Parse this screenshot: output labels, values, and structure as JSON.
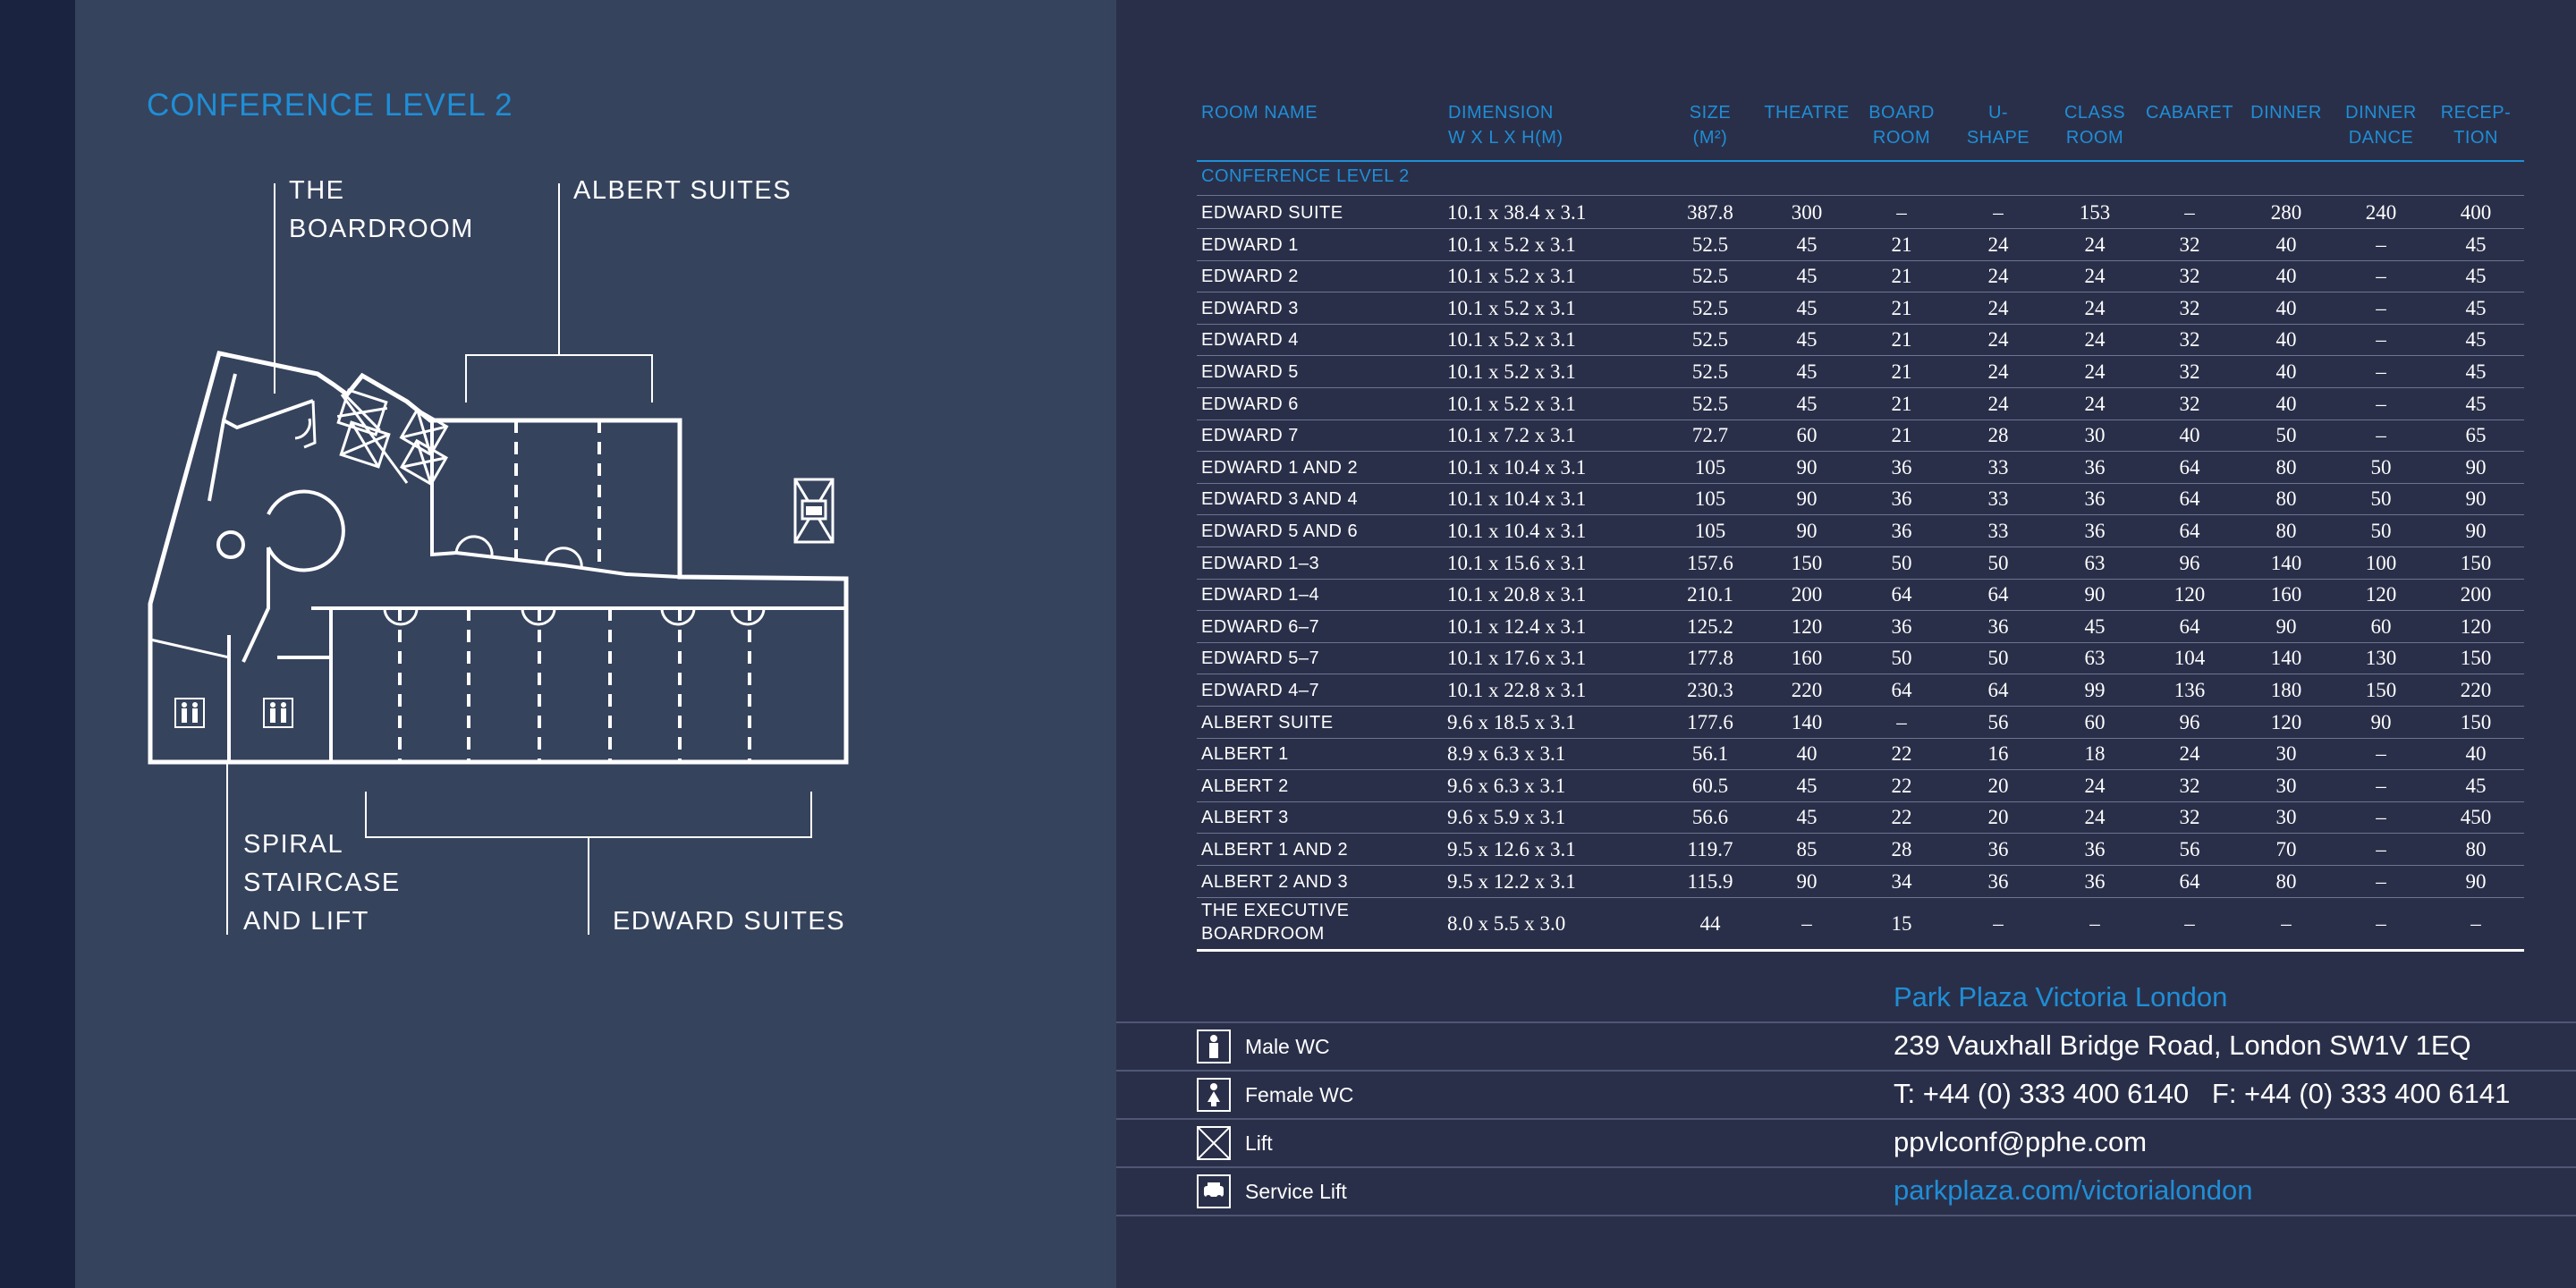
{
  "left": {
    "title": "CONFERENCE LEVEL 2",
    "labels": {
      "boardroom": "THE\nBOARDROOM",
      "albert": "ALBERT SUITES",
      "spiral": "SPIRAL\nSTAIRCASE\nAND LIFT",
      "edward": "EDWARD SUITES"
    }
  },
  "table": {
    "headers": {
      "room": "ROOM NAME",
      "dim": "DIMENSION\nW X L X H(M)",
      "size": "SIZE\n(M²)",
      "theatre": "THEATRE",
      "board": "BOARD\nROOM",
      "ushape": "U-\nSHAPE",
      "class": "CLASS\nROOM",
      "cabaret": "CABARET",
      "dinner": "DINNER",
      "dance": "DINNER\nDANCE",
      "reception": "RECEP-\nTION"
    },
    "section": "CONFERENCE LEVEL 2",
    "rows": [
      {
        "name": "EDWARD SUITE",
        "dim": "10.1 x 38.4 x 3.1",
        "size": "387.8",
        "theatre": "300",
        "board": "–",
        "ushape": "–",
        "class": "153",
        "cabaret": "–",
        "dinner": "280",
        "dance": "240",
        "reception": "400"
      },
      {
        "name": "EDWARD 1",
        "dim": "10.1 x 5.2 x 3.1",
        "size": "52.5",
        "theatre": "45",
        "board": "21",
        "ushape": "24",
        "class": "24",
        "cabaret": "32",
        "dinner": "40",
        "dance": "–",
        "reception": "45"
      },
      {
        "name": "EDWARD 2",
        "dim": "10.1 x 5.2 x 3.1",
        "size": "52.5",
        "theatre": "45",
        "board": "21",
        "ushape": "24",
        "class": "24",
        "cabaret": "32",
        "dinner": "40",
        "dance": "–",
        "reception": "45"
      },
      {
        "name": "EDWARD 3",
        "dim": "10.1 x 5.2 x 3.1",
        "size": "52.5",
        "theatre": "45",
        "board": "21",
        "ushape": "24",
        "class": "24",
        "cabaret": "32",
        "dinner": "40",
        "dance": "–",
        "reception": "45"
      },
      {
        "name": "EDWARD 4",
        "dim": "10.1 x 5.2 x 3.1",
        "size": "52.5",
        "theatre": "45",
        "board": "21",
        "ushape": "24",
        "class": "24",
        "cabaret": "32",
        "dinner": "40",
        "dance": "–",
        "reception": "45"
      },
      {
        "name": "EDWARD 5",
        "dim": "10.1 x 5.2 x 3.1",
        "size": "52.5",
        "theatre": "45",
        "board": "21",
        "ushape": "24",
        "class": "24",
        "cabaret": "32",
        "dinner": "40",
        "dance": "–",
        "reception": "45"
      },
      {
        "name": "EDWARD 6",
        "dim": "10.1 x 5.2 x 3.1",
        "size": "52.5",
        "theatre": "45",
        "board": "21",
        "ushape": "24",
        "class": "24",
        "cabaret": "32",
        "dinner": "40",
        "dance": "–",
        "reception": "45"
      },
      {
        "name": "EDWARD 7",
        "dim": "10.1 x 7.2 x 3.1",
        "size": "72.7",
        "theatre": "60",
        "board": "21",
        "ushape": "28",
        "class": "30",
        "cabaret": "40",
        "dinner": "50",
        "dance": "–",
        "reception": "65"
      },
      {
        "name": "EDWARD 1 AND 2",
        "dim": "10.1 x 10.4 x 3.1",
        "size": "105",
        "theatre": "90",
        "board": "36",
        "ushape": "33",
        "class": "36",
        "cabaret": "64",
        "dinner": "80",
        "dance": "50",
        "reception": "90"
      },
      {
        "name": "EDWARD 3 AND 4",
        "dim": "10.1 x 10.4 x 3.1",
        "size": "105",
        "theatre": "90",
        "board": "36",
        "ushape": "33",
        "class": "36",
        "cabaret": "64",
        "dinner": "80",
        "dance": "50",
        "reception": "90"
      },
      {
        "name": "EDWARD 5 AND 6",
        "dim": "10.1 x 10.4 x 3.1",
        "size": "105",
        "theatre": "90",
        "board": "36",
        "ushape": "33",
        "class": "36",
        "cabaret": "64",
        "dinner": "80",
        "dance": "50",
        "reception": "90"
      },
      {
        "name": "EDWARD 1–3",
        "dim": "10.1 x 15.6 x 3.1",
        "size": "157.6",
        "theatre": "150",
        "board": "50",
        "ushape": "50",
        "class": "63",
        "cabaret": "96",
        "dinner": "140",
        "dance": "100",
        "reception": "150"
      },
      {
        "name": "EDWARD 1–4",
        "dim": "10.1 x 20.8 x 3.1",
        "size": "210.1",
        "theatre": "200",
        "board": "64",
        "ushape": "64",
        "class": "90",
        "cabaret": "120",
        "dinner": "160",
        "dance": "120",
        "reception": "200"
      },
      {
        "name": "EDWARD 6–7",
        "dim": "10.1 x 12.4 x 3.1",
        "size": "125.2",
        "theatre": "120",
        "board": "36",
        "ushape": "36",
        "class": "45",
        "cabaret": "64",
        "dinner": "90",
        "dance": "60",
        "reception": "120"
      },
      {
        "name": "EDWARD 5–7",
        "dim": "10.1 x 17.6 x 3.1",
        "size": "177.8",
        "theatre": "160",
        "board": "50",
        "ushape": "50",
        "class": "63",
        "cabaret": "104",
        "dinner": "140",
        "dance": "130",
        "reception": "150"
      },
      {
        "name": "EDWARD 4–7",
        "dim": "10.1 x 22.8 x 3.1",
        "size": "230.3",
        "theatre": "220",
        "board": "64",
        "ushape": "64",
        "class": "99",
        "cabaret": "136",
        "dinner": "180",
        "dance": "150",
        "reception": "220"
      },
      {
        "name": "ALBERT SUITE",
        "dim": "9.6 x 18.5 x 3.1",
        "size": "177.6",
        "theatre": "140",
        "board": "–",
        "ushape": "56",
        "class": "60",
        "cabaret": "96",
        "dinner": "120",
        "dance": "90",
        "reception": "150"
      },
      {
        "name": "ALBERT 1",
        "dim": "8.9 x 6.3 x 3.1",
        "size": "56.1",
        "theatre": "40",
        "board": "22",
        "ushape": "16",
        "class": "18",
        "cabaret": "24",
        "dinner": "30",
        "dance": "–",
        "reception": "40"
      },
      {
        "name": "ALBERT 2",
        "dim": "9.6 x 6.3 x 3.1",
        "size": "60.5",
        "theatre": "45",
        "board": "22",
        "ushape": "20",
        "class": "24",
        "cabaret": "32",
        "dinner": "30",
        "dance": "–",
        "reception": "45"
      },
      {
        "name": "ALBERT 3",
        "dim": "9.6 x 5.9 x 3.1",
        "size": "56.6",
        "theatre": "45",
        "board": "22",
        "ushape": "20",
        "class": "24",
        "cabaret": "32",
        "dinner": "30",
        "dance": "–",
        "reception": "450"
      },
      {
        "name": "ALBERT 1 AND 2",
        "dim": "9.5 x 12.6 x 3.1",
        "size": "119.7",
        "theatre": "85",
        "board": "28",
        "ushape": "36",
        "class": "36",
        "cabaret": "56",
        "dinner": "70",
        "dance": "–",
        "reception": "80"
      },
      {
        "name": "ALBERT 2 AND 3",
        "dim": "9.5 x 12.2 x 3.1",
        "size": "115.9",
        "theatre": "90",
        "board": "34",
        "ushape": "36",
        "class": "36",
        "cabaret": "64",
        "dinner": "80",
        "dance": "–",
        "reception": "90"
      }
    ],
    "exec": {
      "name": "THE EXECUTIVE\nBOARDROOM",
      "dim": "8.0 x 5.5 x 3.0",
      "size": "44",
      "theatre": "–",
      "board": "15",
      "ushape": "–",
      "class": "–",
      "cabaret": "–",
      "dinner": "–",
      "dance": "–",
      "reception": "–"
    }
  },
  "legend": [
    {
      "icon": "male-wc-icon",
      "label": "Male WC"
    },
    {
      "icon": "female-wc-icon",
      "label": "Female WC"
    },
    {
      "icon": "lift-icon",
      "label": "Lift"
    },
    {
      "icon": "service-lift-icon",
      "label": "Service Lift"
    }
  ],
  "contact": {
    "hotel": "Park Plaza Victoria London",
    "address": "239 Vauxhall Bridge Road, London SW1V 1EQ",
    "phone": "T: +44 (0) 333 400 6140   F: +44 (0) 333 400 6141",
    "email": "ppvlconf@pphe.com",
    "web": "parkplaza.com/victorialondon"
  },
  "colors": {
    "accent": "#1f8ed6",
    "left_bg": "#36435d",
    "right_bg": "#2a2f49",
    "spine": "#1a2440"
  }
}
